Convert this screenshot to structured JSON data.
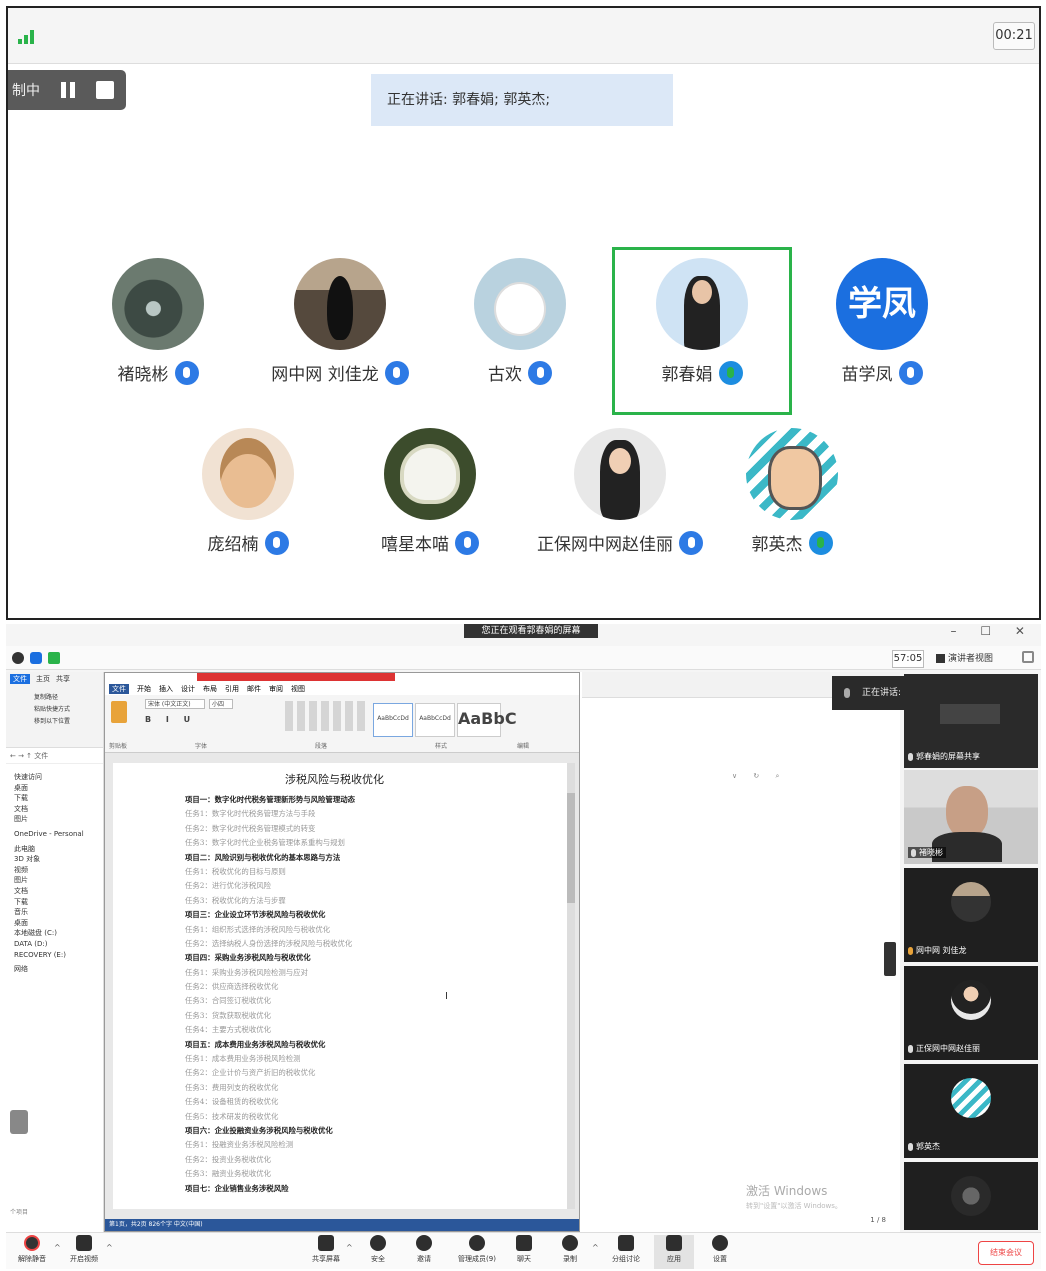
{
  "top_panel": {
    "timer": "00:21",
    "recording": {
      "label": "制中"
    },
    "talking_banner": "正在讲话: 郭春娟; 郭英杰;",
    "participants_row1": [
      {
        "name": "褚晓彬",
        "avatar": "photo-water-drop"
      },
      {
        "name": "网中网 刘佳龙",
        "avatar": "photo-silhouette"
      },
      {
        "name": "古欢",
        "avatar": "photo-bunny"
      },
      {
        "name": "郭春娟",
        "avatar": "photo-woman",
        "active": true
      },
      {
        "name": "苗学凤",
        "avatar_text": "学凤"
      }
    ],
    "participants_row2": [
      {
        "name": "庞绍楠",
        "avatar": "photo-cartoon-girl"
      },
      {
        "name": "嘻星本喵",
        "avatar": "photo-lotus"
      },
      {
        "name": "正保网中网赵佳丽",
        "avatar": "photo-woman-white"
      },
      {
        "name": "郭英杰",
        "avatar": "cartoon-man-glasses"
      }
    ]
  },
  "zoom_window": {
    "share_banner": "您正在观看郭春娟的屏幕",
    "window_controls": "– ☐ ✕",
    "clock": "57:05",
    "view_button": "演讲者视图",
    "toast": "正在讲话: 郭春娟",
    "explorer": {
      "tabs": [
        "文件",
        "主页",
        "共享"
      ],
      "ribbon_items": [
        "复制路径",
        "粘贴快捷方式",
        "移到以下位置"
      ],
      "address": "← → ↑ 文件",
      "items": [
        "快速访问",
        "桌面",
        "下载",
        "文档",
        "图片"
      ],
      "items2": [
        "OneDrive - Personal"
      ],
      "items3": [
        "此电脑",
        "3D 对象",
        "视频",
        "图片",
        "文档",
        "下载",
        "音乐",
        "桌面",
        "本地磁盘 (C:)",
        "DATA (D:)",
        "RECOVERY (E:)"
      ],
      "items4": [
        "网络"
      ],
      "status": "个项目"
    },
    "word": {
      "tabs": [
        "文件",
        "开始",
        "插入",
        "设计",
        "布局",
        "引用",
        "邮件",
        "审阅",
        "视图"
      ],
      "font_name": "宋体 (中文正文)",
      "font_size": "小四",
      "styles": [
        "AaBbCcDd",
        "AaBbCcDd",
        "AaBbC"
      ],
      "style_names": [
        "正文",
        "无间隔",
        "标题 1"
      ],
      "groups": [
        "剪贴板",
        "字体",
        "段落",
        "样式",
        "编辑"
      ],
      "doc_title": "涉税风险与税收优化",
      "doc_lines": [
        {
          "text": "项目一：数字化时代税务管理新形势与风险管理动态",
          "heading": true
        },
        {
          "text": "任务1：数字化时代税务管理方法与手段",
          "heading": false
        },
        {
          "text": "任务2：数字化时代税务管理模式的转变",
          "heading": false
        },
        {
          "text": "任务3：数字化时代企业税务管理体系重构与规划",
          "heading": false
        },
        {
          "text": "项目二：风险识别与税收优化的基本思路与方法",
          "heading": true
        },
        {
          "text": "任务1：税收优化的目标与原则",
          "heading": false
        },
        {
          "text": "任务2：进行优化涉税风险",
          "heading": false
        },
        {
          "text": "任务3：税收优化的方法与步骤",
          "heading": false
        },
        {
          "text": "项目三：企业设立环节涉税风险与税收优化",
          "heading": true
        },
        {
          "text": "任务1：组织形式选择的涉税风险与税收优化",
          "heading": false
        },
        {
          "text": "任务2：选择纳税人身份选择的涉税风险与税收优化",
          "heading": false
        },
        {
          "text": "项目四：采购业务涉税风险与税收优化",
          "heading": true
        },
        {
          "text": "任务1：采购业务涉税风险检测与应对",
          "heading": false
        },
        {
          "text": "任务2：供应商选择税收优化",
          "heading": false
        },
        {
          "text": "任务3：合同签订税收优化",
          "heading": false
        },
        {
          "text": "任务3：货款获取税收优化",
          "heading": false
        },
        {
          "text": "任务4：主要方式税收优化",
          "heading": false
        },
        {
          "text": "项目五：成本费用业务涉税风险与税收优化",
          "heading": true
        },
        {
          "text": "任务1：成本费用业务涉税风险检测",
          "heading": false
        },
        {
          "text": "任务2：企业计价与资产折旧的税收优化",
          "heading": false
        },
        {
          "text": "任务3：费用列支的税收优化",
          "heading": false
        },
        {
          "text": "任务4：设备租赁的税收优化",
          "heading": false
        },
        {
          "text": "任务5：技术研发的税收优化",
          "heading": false
        },
        {
          "text": "项目六：企业投融资业务涉税风险与税收优化",
          "heading": true
        },
        {
          "text": "任务1：投融资业务涉税风险检测",
          "heading": false
        },
        {
          "text": "任务2：投资业务税收优化",
          "heading": false
        },
        {
          "text": "任务3：融资业务税收优化",
          "heading": false
        },
        {
          "text": "项目七：企业销售业务涉税风险",
          "heading": true
        }
      ],
      "cursor_char": "I",
      "status": "第1页，共2页  826个字  中文(中国)"
    },
    "browser": {
      "search_items": [
        "∨",
        "↻",
        "⌕"
      ],
      "activate_title": "激活 Windows",
      "activate_sub": "转到\"设置\"以激活 Windows。",
      "page_indicator": "1 / 8"
    },
    "sidebar_tiles": [
      {
        "name": "郭春娟的屏幕共享",
        "kind": "screen-share"
      },
      {
        "name": "褚晓彬",
        "kind": "video"
      },
      {
        "name": "网中网 刘佳龙",
        "kind": "avatar"
      },
      {
        "name": "正保网中网赵佳丽",
        "kind": "avatar"
      },
      {
        "name": "郭英杰",
        "kind": "avatar"
      },
      {
        "name": "",
        "kind": "avatar"
      }
    ],
    "toolbar": {
      "mute": "解除静音",
      "video": "开启视频",
      "share": "共享屏幕",
      "security": "安全",
      "invite": "邀请",
      "participants": "管理成员(9)",
      "chat": "聊天",
      "record": "录制",
      "breakout": "分组讨论",
      "apps": "应用",
      "settings": "设置",
      "end": "结束会议"
    }
  }
}
